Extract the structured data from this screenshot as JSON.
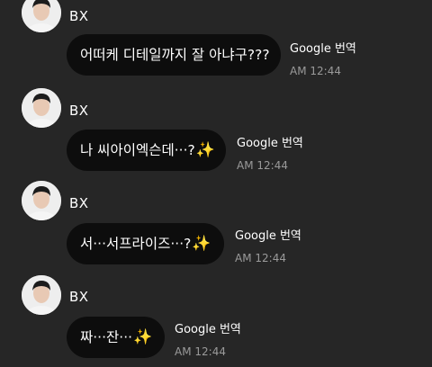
{
  "messages": [
    {
      "sender": "BX",
      "text": "어떠케 디테일까지 잘 아냐구???",
      "emoji": "",
      "translate_label": "Google 번역",
      "time": "AM 12:44"
    },
    {
      "sender": "BX",
      "text": "나 씨아이엑슨데···?",
      "emoji": "✨",
      "translate_label": "Google 번역",
      "time": "AM 12:44"
    },
    {
      "sender": "BX",
      "text": "서···서프라이즈···?",
      "emoji": "✨",
      "translate_label": "Google 번역",
      "time": "AM 12:44"
    },
    {
      "sender": "BX",
      "text": "짜···잔···",
      "emoji": "✨",
      "translate_label": "Google 번역",
      "time": "AM 12:44"
    }
  ],
  "icons": {
    "avatar": "avatar-photo",
    "sparkle": "sparkles-emoji"
  },
  "colors": {
    "background": "#262626",
    "bubble": "#0d0d0d",
    "sparkle": "#ffc83d",
    "time": "#9a9a9a"
  }
}
